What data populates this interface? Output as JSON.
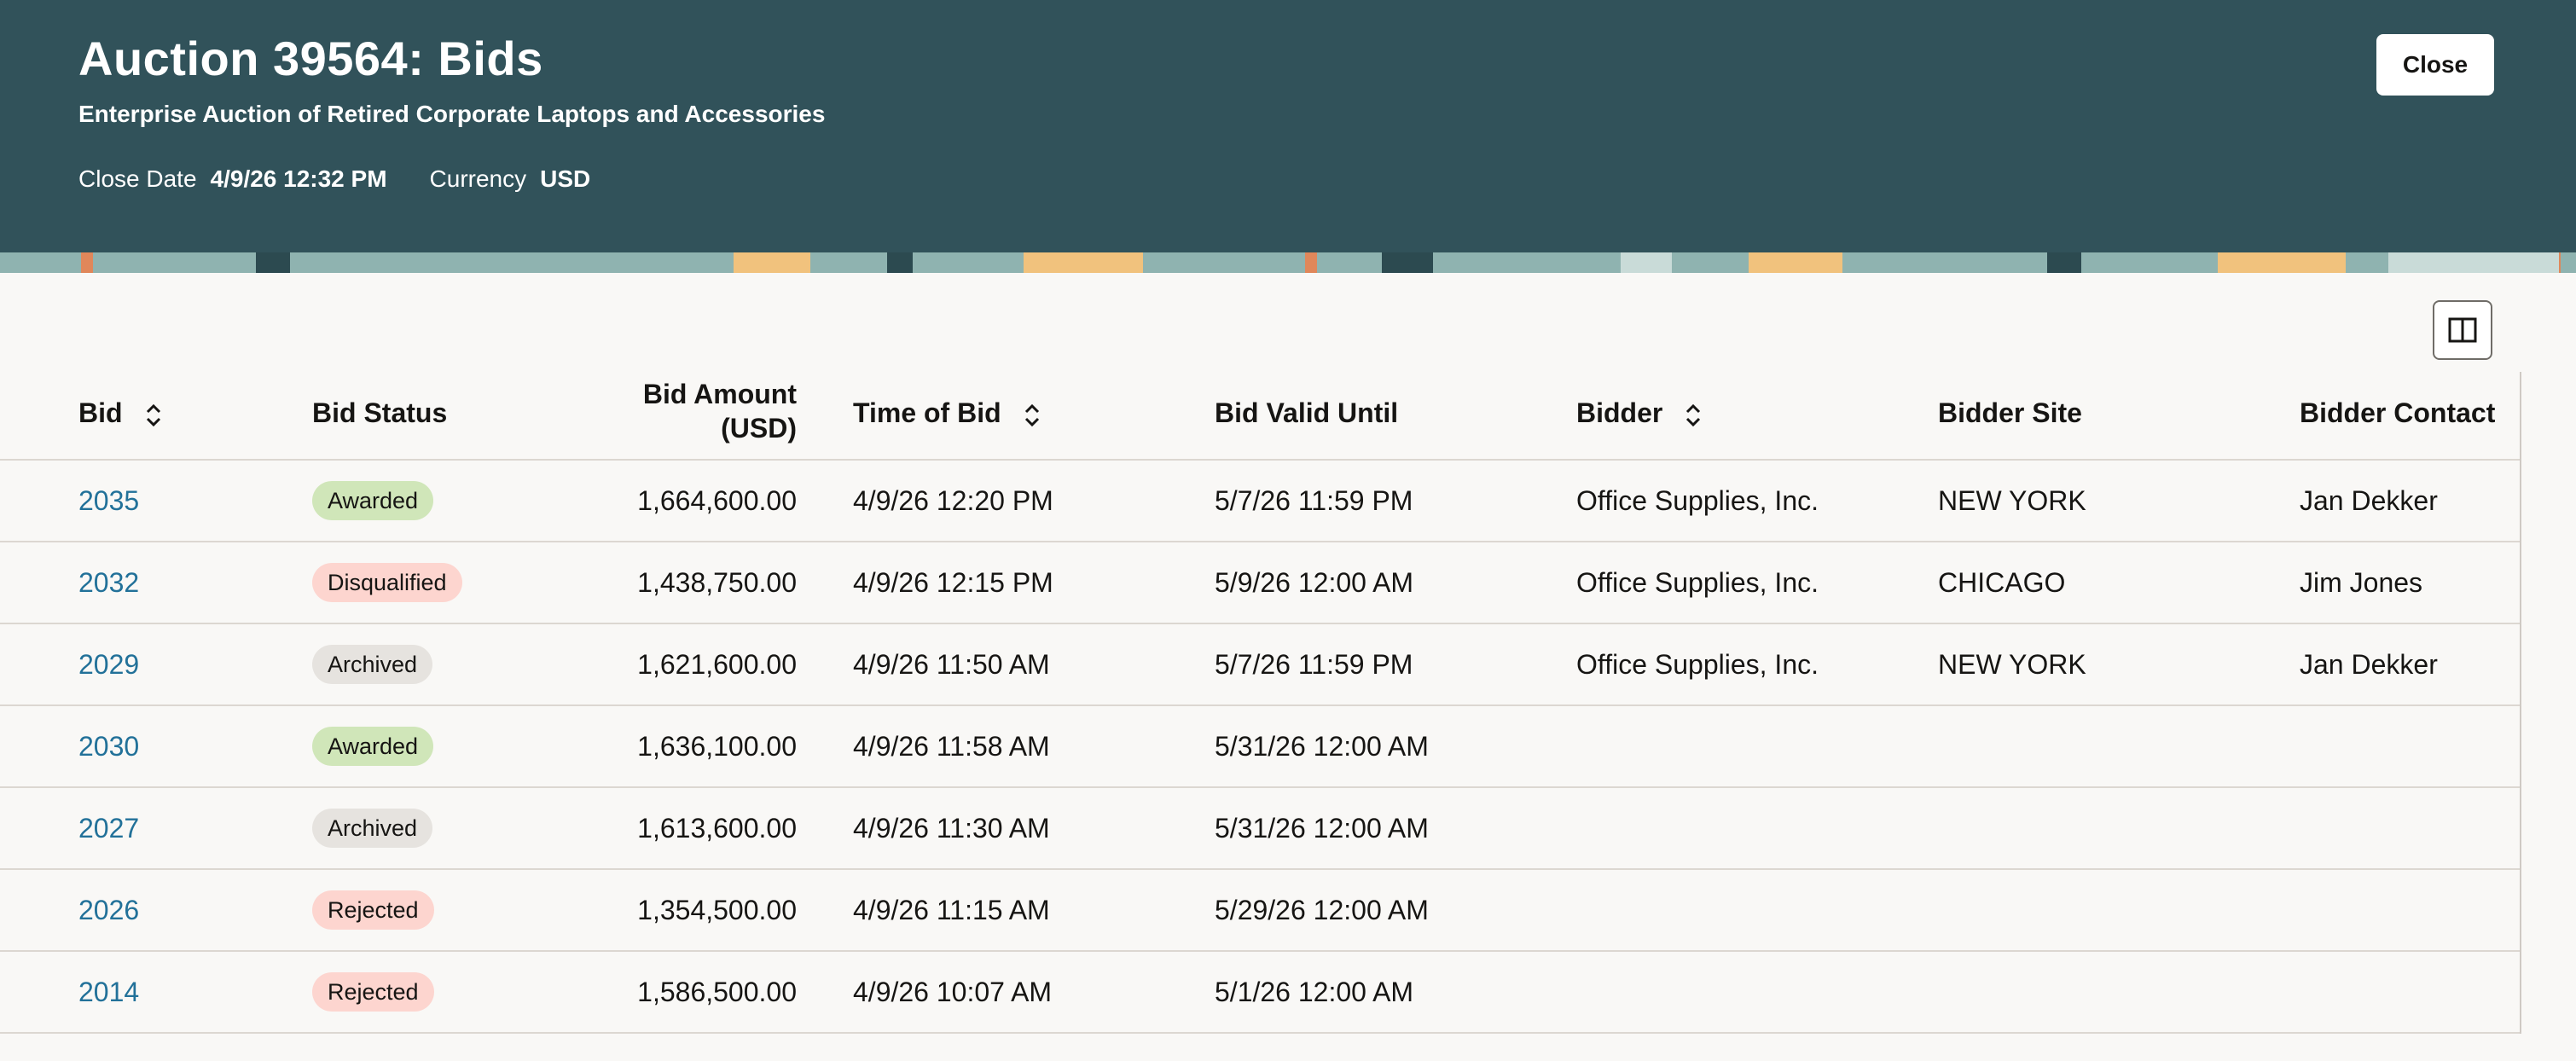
{
  "header": {
    "title": "Auction 39564: Bids",
    "subtitle": "Enterprise Auction of Retired Corporate Laptops and Accessories",
    "close_date_label": "Close Date",
    "close_date_value": "4/9/26 12:32 PM",
    "currency_label": "Currency",
    "currency_value": "USD",
    "close_button": "Close",
    "colors": {
      "background": "#31525a",
      "text": "#ffffff"
    }
  },
  "toolbar": {
    "column_manager_icon": "split-columns-icon"
  },
  "table": {
    "headers": {
      "bid": "Bid",
      "bid_status": "Bid Status",
      "bid_amount_line1": "Bid Amount",
      "bid_amount_line2": "(USD)",
      "time_of_bid": "Time of Bid",
      "bid_valid_until": "Bid Valid Until",
      "bidder": "Bidder",
      "bidder_site": "Bidder Site",
      "bidder_contact": "Bidder Contact"
    },
    "sortable_columns": [
      "Bid",
      "Time of Bid",
      "Bidder"
    ],
    "rows": [
      {
        "bid": "2035",
        "status": "Awarded",
        "amount": "1,664,600.00",
        "time": "4/9/26 12:20 PM",
        "valid_until": "5/7/26 11:59 PM",
        "bidder": "Office Supplies, Inc.",
        "site": "NEW YORK",
        "contact": "Jan Dekker"
      },
      {
        "bid": "2032",
        "status": "Disqualified",
        "amount": "1,438,750.00",
        "time": "4/9/26 12:15 PM",
        "valid_until": "5/9/26 12:00 AM",
        "bidder": "Office Supplies, Inc.",
        "site": "CHICAGO",
        "contact": "Jim Jones"
      },
      {
        "bid": "2029",
        "status": "Archived",
        "amount": "1,621,600.00",
        "time": "4/9/26 11:50 AM",
        "valid_until": "5/7/26 11:59 PM",
        "bidder": "Office Supplies, Inc.",
        "site": "NEW YORK",
        "contact": "Jan Dekker"
      },
      {
        "bid": "2030",
        "status": "Awarded",
        "amount": "1,636,100.00",
        "time": "4/9/26 11:58 AM",
        "valid_until": "5/31/26 12:00 AM",
        "bidder": "",
        "site": "",
        "contact": ""
      },
      {
        "bid": "2027",
        "status": "Archived",
        "amount": "1,613,600.00",
        "time": "4/9/26 11:30 AM",
        "valid_until": "5/31/26 12:00 AM",
        "bidder": "",
        "site": "",
        "contact": ""
      },
      {
        "bid": "2026",
        "status": "Rejected",
        "amount": "1,354,500.00",
        "time": "4/9/26 11:15 AM",
        "valid_until": "5/29/26 12:00 AM",
        "bidder": "",
        "site": "",
        "contact": ""
      },
      {
        "bid": "2014",
        "status": "Rejected",
        "amount": "1,586,500.00",
        "time": "4/9/26 10:07 AM",
        "valid_until": "5/1/26 12:00 AM",
        "bidder": "",
        "site": "",
        "contact": ""
      }
    ],
    "status_colors": {
      "Awarded": "#d0e6b9",
      "Disqualified": "#fdd5cf",
      "Rejected": "#fdd5cf",
      "Archived": "#e6e3df"
    },
    "link_color": "#227199"
  }
}
